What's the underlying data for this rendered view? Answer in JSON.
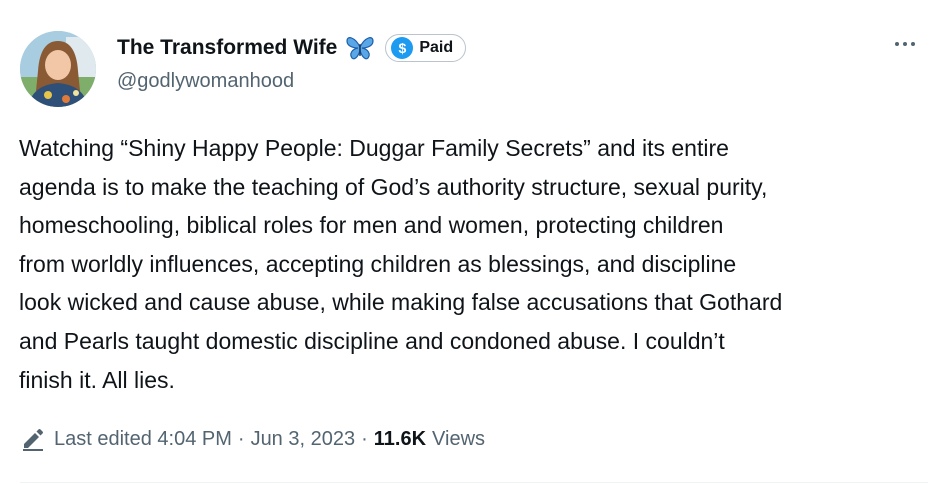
{
  "author": {
    "display_name": "The Transformed Wife",
    "handle": "@godlywomanhood",
    "avatar_icon": "profile-photo",
    "emoji_icon": "butterfly-icon",
    "badge_label": "Paid",
    "badge_icon": "dollar-icon",
    "badge_color": "#1d9bf0"
  },
  "more_icon": "more-horizontal-icon",
  "tweet": {
    "lines": [
      "Watching “Shiny Happy People: Duggar Family Secrets” and its entire",
      "agenda is to make the teaching of God’s authority structure, sexual purity,",
      "homeschooling, biblical roles for men and women, protecting children",
      "from worldly influences, accepting children as blessings, and discipline",
      "look wicked and cause abuse, while making false accusations that Gothard",
      "and Pearls taught domestic discipline and condoned abuse. I couldn’t",
      "finish it. All lies."
    ]
  },
  "meta": {
    "edit_icon": "pencil-icon",
    "edited_text": "Last edited 4:04 PM",
    "separator": "·",
    "date": "Jun 3, 2023",
    "views_count": "11.6K",
    "views_label": "Views"
  },
  "colors": {
    "text_primary": "#0f1419",
    "text_secondary": "#536471",
    "accent": "#1d9bf0"
  }
}
